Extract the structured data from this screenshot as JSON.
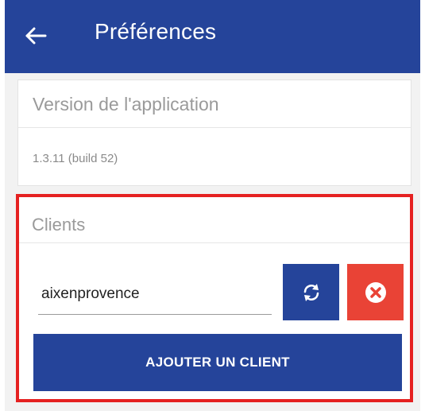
{
  "appbar": {
    "title": "Préférences",
    "back_icon": "arrow-left-icon",
    "color": "#25449a"
  },
  "version_section": {
    "header": "Version de l'application",
    "value": "1.3.11 (build 52)"
  },
  "clients_section": {
    "header": "Clients",
    "highlight_color": "#e52121",
    "client_input": {
      "value": "aixenprovence"
    },
    "refresh_icon": "sync-icon",
    "delete_icon": "close-circle-icon",
    "delete_color": "#e94336",
    "add_button_label": "AJOUTER UN CLIENT"
  }
}
